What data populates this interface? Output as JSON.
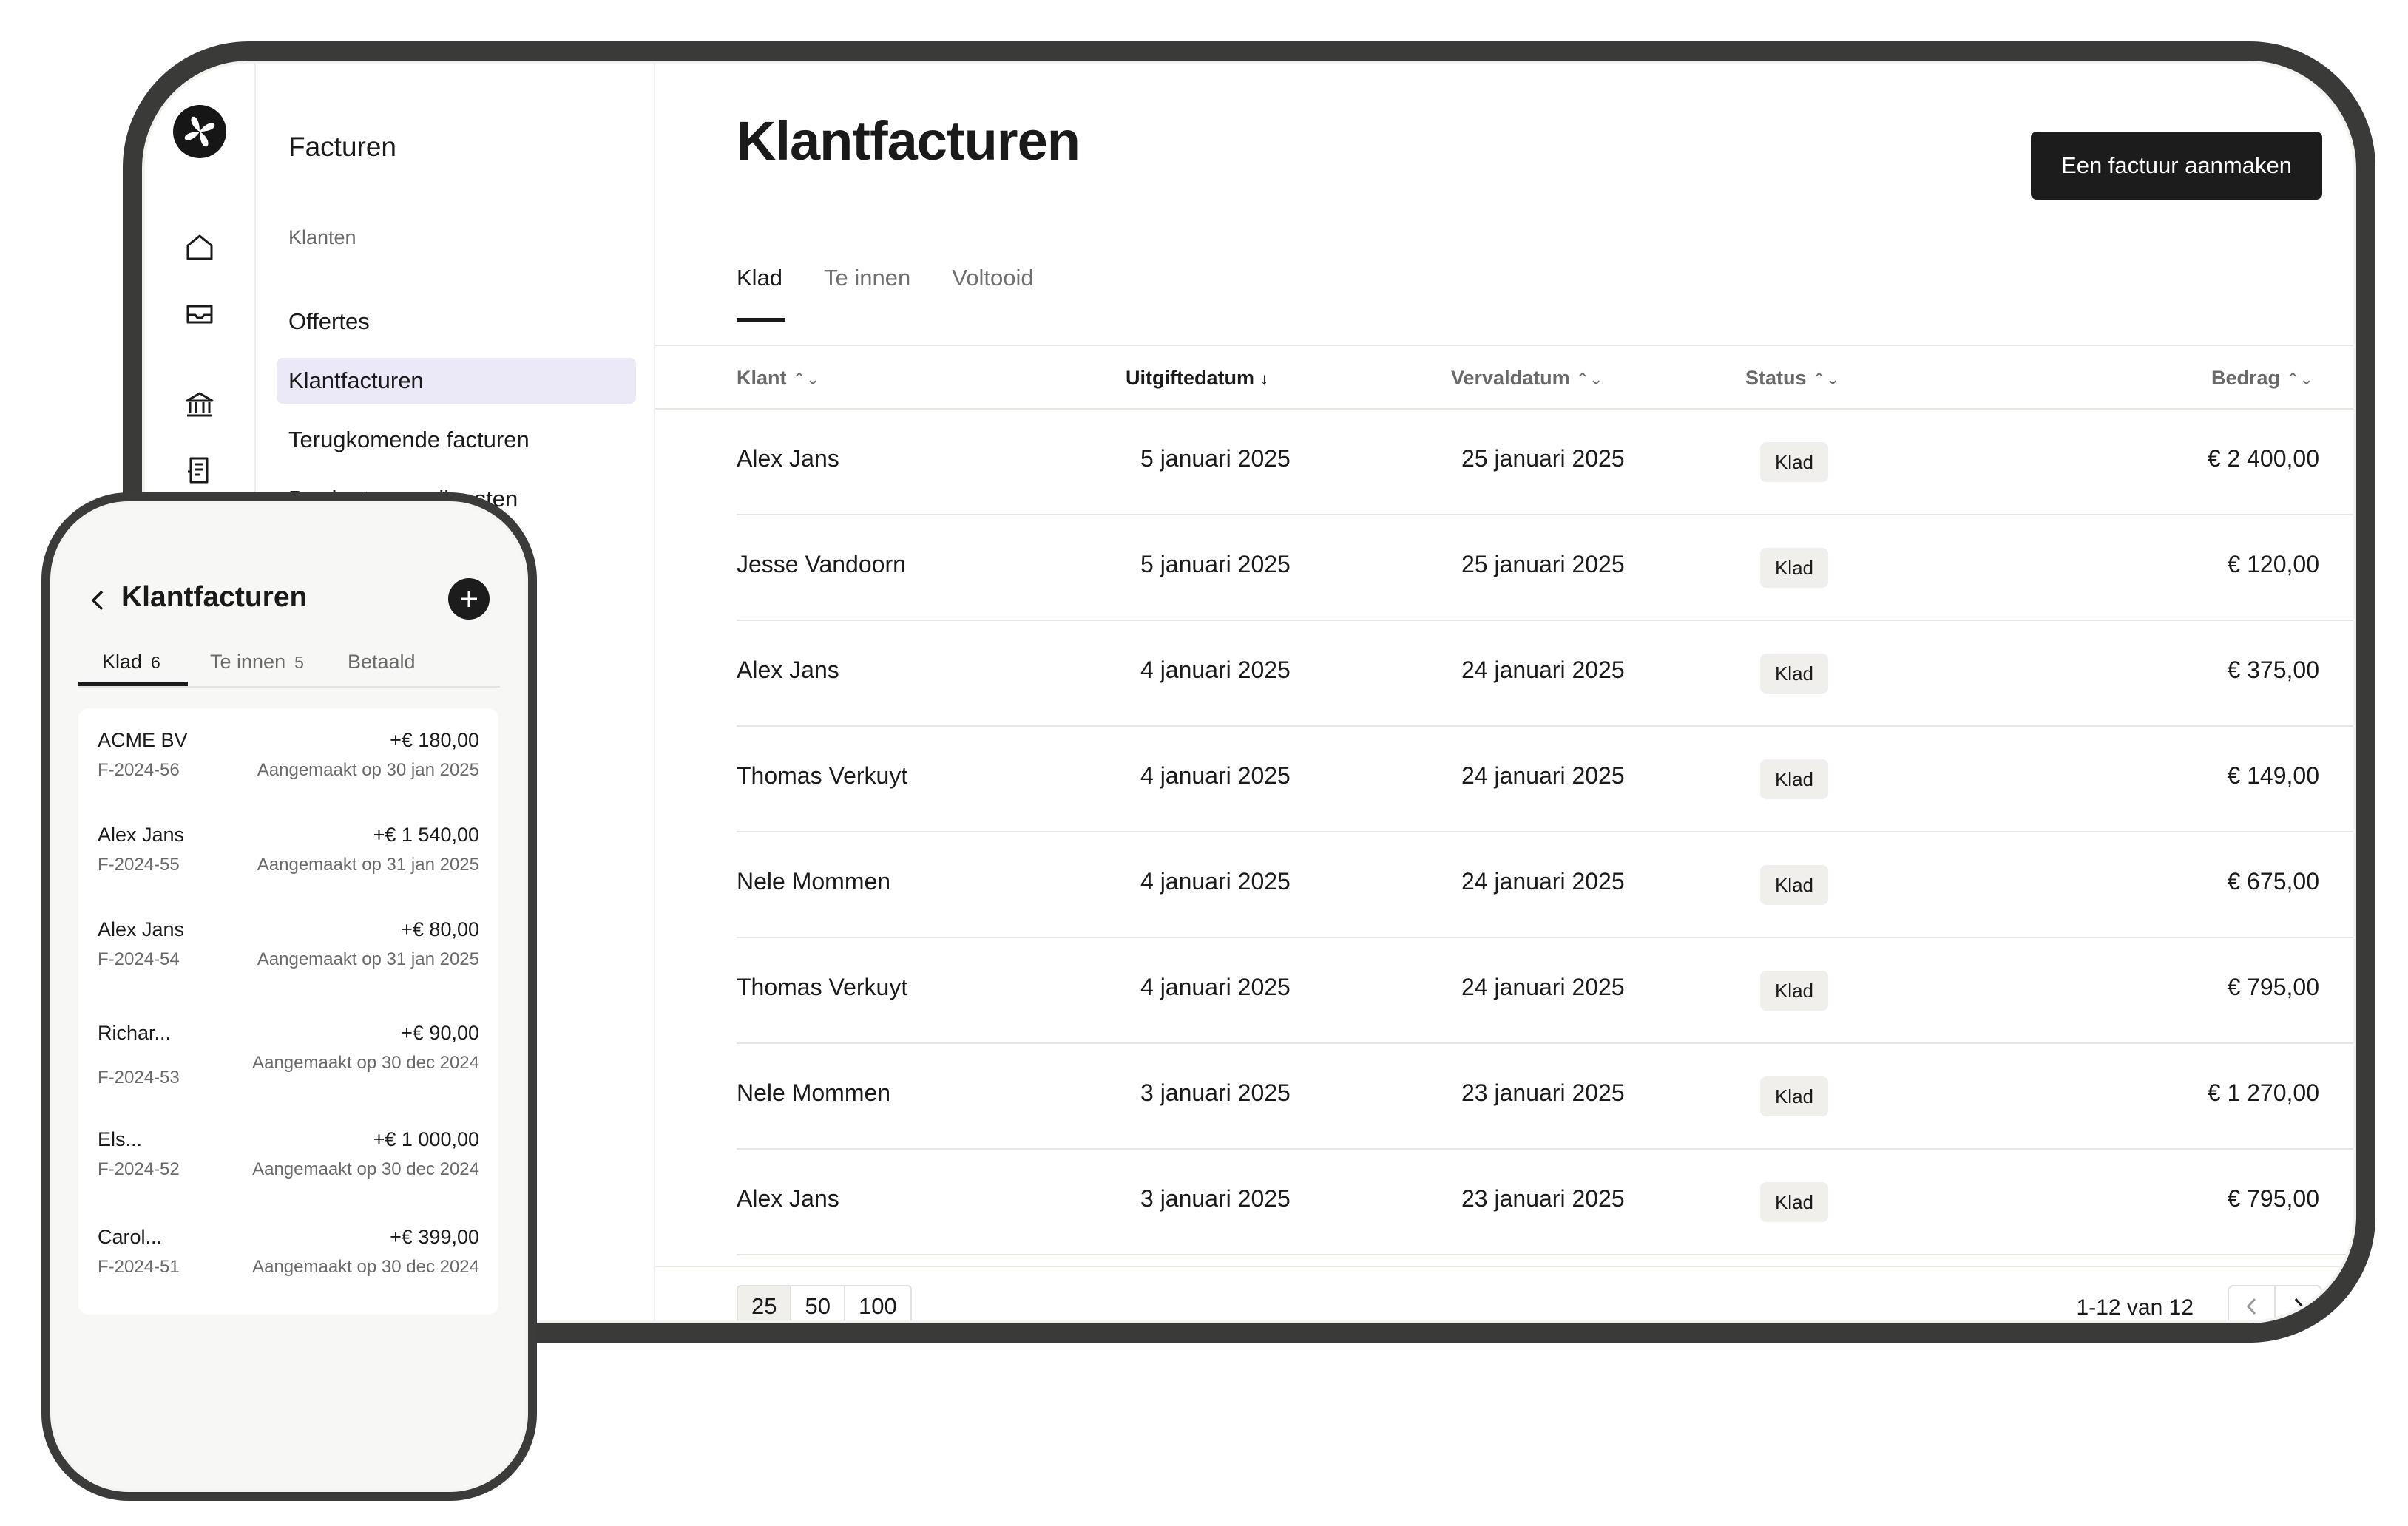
{
  "sidebar": {
    "title": "Facturen",
    "group_label": "Klanten",
    "items": [
      {
        "label": "Offertes"
      },
      {
        "label": "Klantfacturen"
      },
      {
        "label": "Terugkomende facturen"
      },
      {
        "label": "Producten en diensten"
      }
    ],
    "rail_icons": [
      "home-icon",
      "inbox-icon",
      "bank-icon",
      "invoice-icon"
    ]
  },
  "page": {
    "title": "Klantfacturen",
    "create_button": "Een factuur aanmaken"
  },
  "tabs": [
    {
      "label": "Klad"
    },
    {
      "label": "Te innen"
    },
    {
      "label": "Voltooid"
    }
  ],
  "table": {
    "columns": [
      {
        "label": "Klant",
        "sort": "⌃⌄"
      },
      {
        "label": "Uitgiftedatum",
        "sort": "↓"
      },
      {
        "label": "Vervaldatum",
        "sort": "⌃⌄"
      },
      {
        "label": "Status",
        "sort": "⌃⌄"
      },
      {
        "label": "Bedrag",
        "sort": "⌃⌄"
      }
    ],
    "rows": [
      {
        "client": "Alex Jans",
        "issued": "5 januari 2025",
        "due": "25 januari 2025",
        "status": "Klad",
        "amount": "€ 2 400,00"
      },
      {
        "client": "Jesse Vandoorn",
        "issued": "5 januari 2025",
        "due": "25 januari 2025",
        "status": "Klad",
        "amount": "€ 120,00"
      },
      {
        "client": "Alex Jans",
        "issued": "4 januari 2025",
        "due": "24 januari 2025",
        "status": "Klad",
        "amount": "€ 375,00"
      },
      {
        "client": "Thomas Verkuyt",
        "issued": "4 januari 2025",
        "due": "24 januari 2025",
        "status": "Klad",
        "amount": "€ 149,00"
      },
      {
        "client": "Nele Mommen",
        "issued": "4 januari 2025",
        "due": "24 januari 2025",
        "status": "Klad",
        "amount": "€ 675,00"
      },
      {
        "client": "Thomas Verkuyt",
        "issued": "4 januari 2025",
        "due": "24 januari 2025",
        "status": "Klad",
        "amount": "€ 795,00"
      },
      {
        "client": "Nele Mommen",
        "issued": "3 januari 2025",
        "due": "23 januari 2025",
        "status": "Klad",
        "amount": "€ 1 270,00"
      },
      {
        "client": "Alex Jans",
        "issued": "3 januari 2025",
        "due": "23 januari 2025",
        "status": "Klad",
        "amount": "€ 795,00"
      }
    ]
  },
  "pagination": {
    "page_sizes": [
      "25",
      "50",
      "100"
    ],
    "selected_size": "25",
    "range": "1-12 van 12"
  },
  "phone": {
    "title": "Klantfacturen",
    "tabs": [
      {
        "label": "Klad",
        "count": "6"
      },
      {
        "label": "Te innen",
        "count": "5"
      },
      {
        "label": "Betaald",
        "count": ""
      }
    ],
    "items": [
      {
        "name": "ACME BV",
        "number": "F-2024-56",
        "amount": "+€ 180,00",
        "created": "Aangemaakt op 30 jan 2025"
      },
      {
        "name": "Alex Jans",
        "number": "F-2024-55",
        "amount": "+€ 1 540,00",
        "created": "Aangemaakt op 31 jan 2025"
      },
      {
        "name": "Alex Jans",
        "number": "F-2024-54",
        "amount": "+€ 80,00",
        "created": "Aangemaakt op 31 jan 2025"
      },
      {
        "name": "Richar...",
        "number": "F-2024-53",
        "amount": "+€ 90,00",
        "created": "Aangemaakt op 30 dec 2024"
      },
      {
        "name": "Els...",
        "number": "F-2024-52",
        "amount": "+€ 1 000,00",
        "created": "Aangemaakt op 30 dec 2024"
      },
      {
        "name": "Carol...",
        "number": "F-2024-51",
        "amount": "+€ 399,00",
        "created": "Aangemaakt op 30 dec 2024"
      }
    ]
  },
  "colors": {
    "primary": "#1c1c1c",
    "active_nav": "#ebe8f7",
    "badge": "#f0efec",
    "device_frame": "#3a3a38"
  }
}
